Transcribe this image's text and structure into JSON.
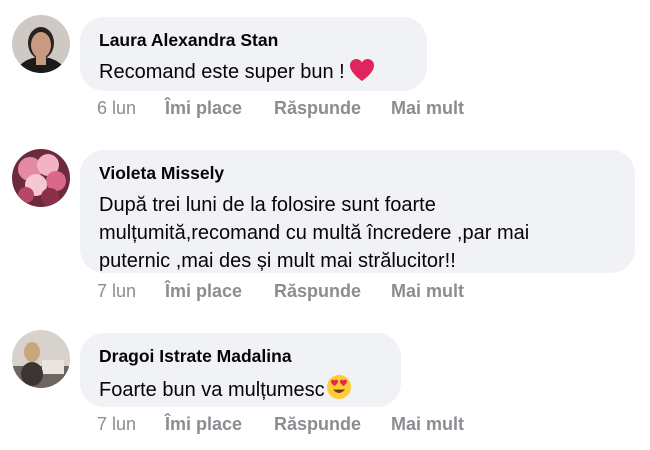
{
  "comments": [
    {
      "author": "Laura Alexandra Stan",
      "text_lines": [
        "Recomand este super bun !"
      ],
      "emoji": "red-heart",
      "time": "6 lun",
      "like_label": "Îmi place",
      "reply_label": "Răspunde",
      "more_label": "Mai mult"
    },
    {
      "author": "Violeta Missely",
      "text_lines": [
        "După trei luni de la folosire sunt foarte",
        "mulțumită,recomand cu multă încredere ,par mai",
        "puternic ,mai des și mult mai strălucitor!!"
      ],
      "time": "7 lun",
      "like_label": "Îmi place",
      "reply_label": "Răspunde",
      "more_label": "Mai mult"
    },
    {
      "author": "Dragoi Istrate Madalina",
      "text_lines": [
        "Foarte bun va mulțumesc"
      ],
      "emoji": "smiling-face-with-heart-eyes",
      "time": "7 lun",
      "like_label": "Îmi place",
      "reply_label": "Răspunde",
      "more_label": "Mai mult"
    }
  ],
  "colors": {
    "bubble": "#f0f2f5",
    "meta_text": "#8a8d91",
    "primary_text": "#050505",
    "heart": "#e0245e"
  }
}
